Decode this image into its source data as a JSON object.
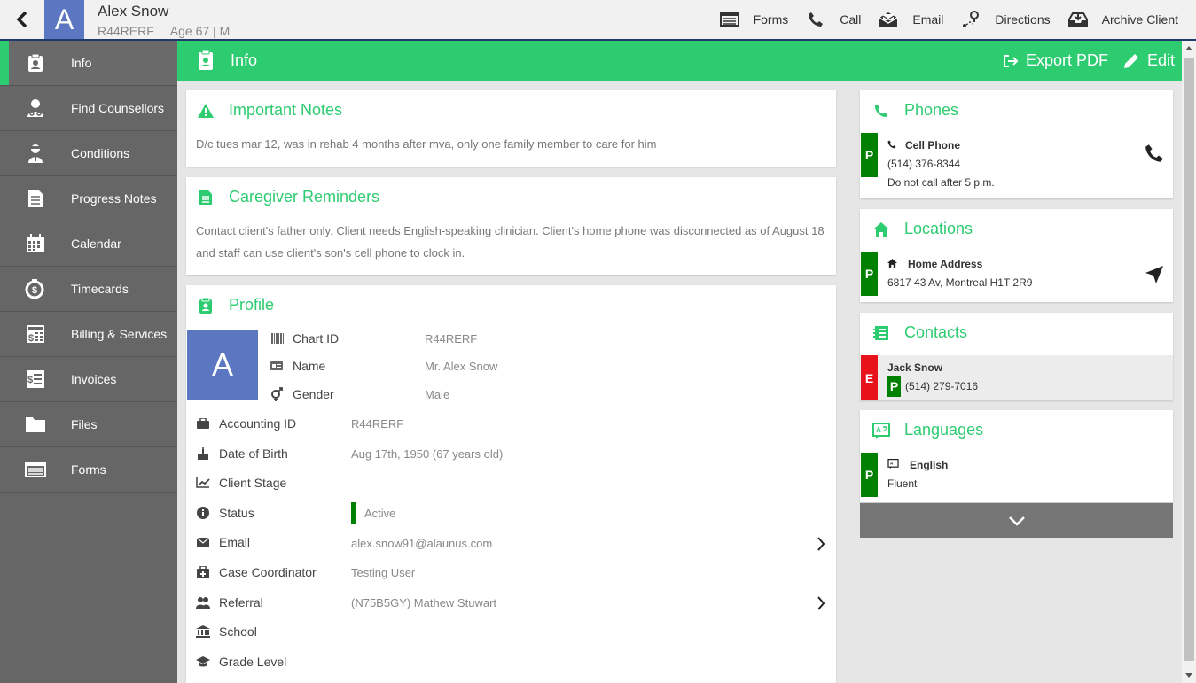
{
  "client": {
    "initial": "A",
    "name": "Alex Snow",
    "chart_id": "R44RERF",
    "age_sex": "Age 67 | M"
  },
  "top_actions": [
    {
      "label": "Forms",
      "icon": "forms-icon"
    },
    {
      "label": "Call",
      "icon": "phone-icon"
    },
    {
      "label": "Email",
      "icon": "email-icon"
    },
    {
      "label": "Directions",
      "icon": "directions-icon"
    },
    {
      "label": "Archive Client",
      "icon": "archive-icon"
    }
  ],
  "sidebar": {
    "items": [
      {
        "label": "Info",
        "icon": "clipboard-icon",
        "active": true
      },
      {
        "label": "Find Counsellors",
        "icon": "doctor-icon"
      },
      {
        "label": "Conditions",
        "icon": "patient-icon"
      },
      {
        "label": "Progress Notes",
        "icon": "document-icon"
      },
      {
        "label": "Calendar",
        "icon": "calendar-icon"
      },
      {
        "label": "Timecards",
        "icon": "timecard-icon"
      },
      {
        "label": "Billing & Services",
        "icon": "billing-icon"
      },
      {
        "label": "Invoices",
        "icon": "invoice-icon"
      },
      {
        "label": "Files",
        "icon": "folder-icon"
      },
      {
        "label": "Forms",
        "icon": "forms-icon"
      }
    ]
  },
  "header": {
    "title": "Info",
    "export_label": "Export PDF",
    "edit_label": "Edit"
  },
  "important_notes": {
    "title": "Important Notes",
    "text": "D/c tues mar 12, was in rehab 4 months after mva, only one family member to care for him"
  },
  "caregiver_reminders": {
    "title": "Caregiver Reminders",
    "text": "Contact client's father only. Client needs English-speaking clinician. Client's home phone was disconnected as of August 18 and staff can use client's son's cell phone to clock in."
  },
  "profile": {
    "title": "Profile",
    "avatar_initial": "A",
    "chart_id_label": "Chart ID",
    "chart_id_value": "R44RERF",
    "name_label": "Name",
    "name_value": "Mr. Alex Snow",
    "gender_label": "Gender",
    "gender_value": "Male",
    "accounting_id_label": "Accounting ID",
    "accounting_id_value": "R44RERF",
    "dob_label": "Date of Birth",
    "dob_value": "Aug 17th, 1950 (67 years old)",
    "client_stage_label": "Client Stage",
    "status_label": "Status",
    "status_value": "Active",
    "email_label": "Email",
    "email_value": "alex.snow91@alaunus.com",
    "case_coordinator_label": "Case Coordinator",
    "case_coordinator_value": "Testing User",
    "referral_label": "Referral",
    "referral_value": "(N75B5GY) Mathew Stuwart",
    "school_label": "School",
    "grade_level_label": "Grade Level"
  },
  "phones": {
    "title": "Phones",
    "tag": "P",
    "type": "Cell Phone",
    "number": "(514) 376-8344",
    "note": "Do not call after 5 p.m."
  },
  "locations": {
    "title": "Locations",
    "tag": "P",
    "type": "Home Address",
    "address": "6817 43 Av, Montreal H1T 2R9"
  },
  "contacts": {
    "title": "Contacts",
    "tag": "E",
    "name": "Jack Snow",
    "phone_tag": "P",
    "phone": "(514) 279-7016"
  },
  "languages": {
    "title": "Languages",
    "tag": "P",
    "language": "English",
    "level": "Fluent"
  },
  "colors": {
    "accent": "#2ecc71",
    "sidebar": "#666666",
    "avatar": "#5b77c2",
    "primary_tag": "#008000",
    "emergency_tag": "#e8131a"
  }
}
